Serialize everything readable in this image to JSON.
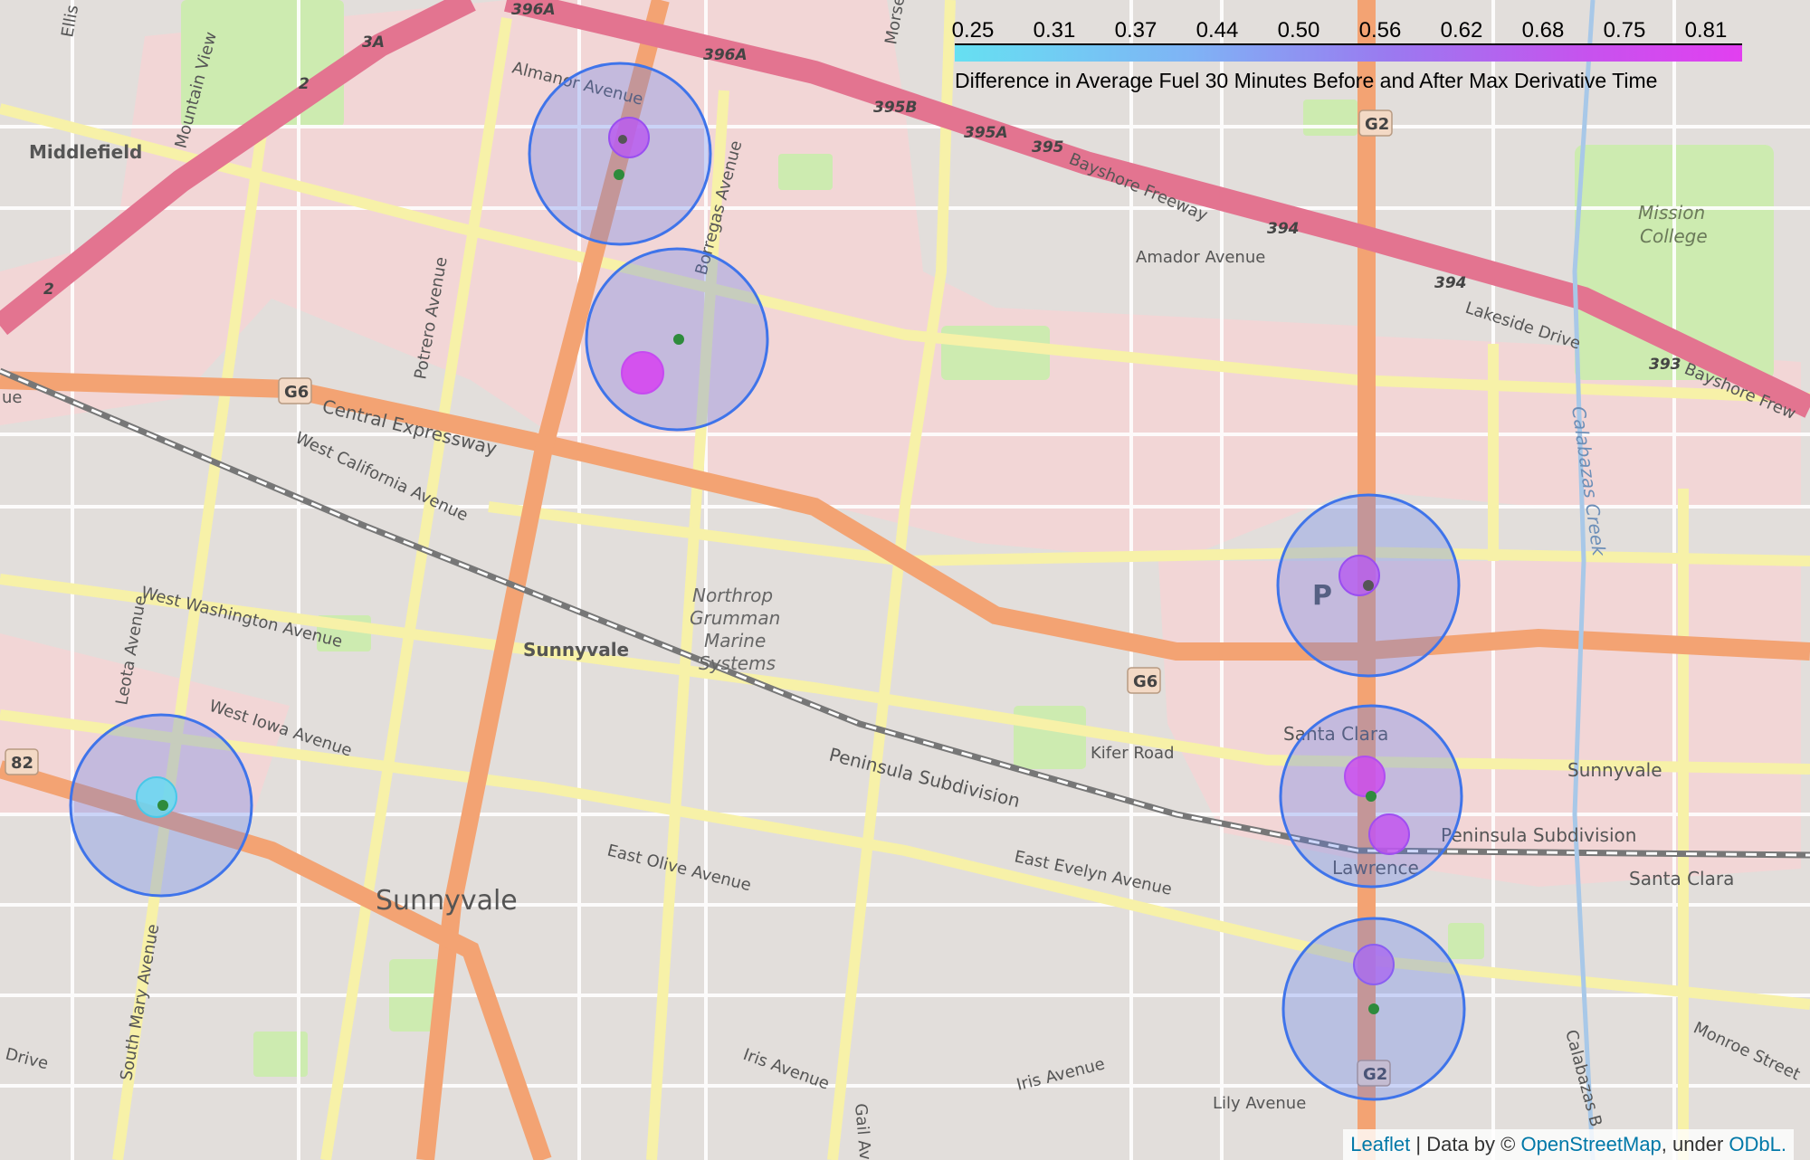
{
  "legend": {
    "ticks": [
      "0.25",
      "0.31",
      "0.37",
      "0.44",
      "0.50",
      "0.56",
      "0.62",
      "0.68",
      "0.75",
      "0.81"
    ],
    "caption": "Difference in Average Fuel 30 Minutes Before and After Max Derivative Time",
    "colors": {
      "low": "#66e0f2",
      "high": "#e23ff0"
    }
  },
  "attribution": {
    "leaflet": "Leaflet",
    "sep": " | Data by © ",
    "osm": "OpenStreetMap",
    "under": ", under ",
    "odbl": "ODbL."
  },
  "places": {
    "sunnyvale_city": "Sunnyvale",
    "sunnyvale_station": "Sunnyvale",
    "middlefield": "Middlefield",
    "lawrence": "Lawrence",
    "santa_clara_1": "Santa Clara",
    "santa_clara_2": "Santa Clara",
    "sunnyvale_east": "Sunnyvale",
    "mission_college_1": "Mission",
    "mission_college_2": "College",
    "northrop_1": "Northrop",
    "northrop_2": "Grumman",
    "northrop_3": "Marine",
    "northrop_4": "Systems",
    "peninsula_1": "Peninsula Subdivision",
    "peninsula_2": "Peninsula Subdivision",
    "parking": "P"
  },
  "streets": {
    "almanor": "Almanor Avenue",
    "borregas": "Borregas Avenue",
    "bayshore_1": "Bayshore Freeway",
    "bayshore_2": "Bayshore Frew",
    "amador": "Amador Avenue",
    "lakeside": "Lakeside Drive",
    "central": "Central Expressway",
    "west_california": "West California Avenue",
    "west_washington": "West Washington Avenue",
    "west_iowa": "West Iowa Avenue",
    "potrero": "Potrero Avenue",
    "leota": "Leota Avenue",
    "kifer": "Kifer Road",
    "east_evelyn": "East Evelyn Avenue",
    "east_olive": "East Olive Avenue",
    "iris_1": "Iris Avenue",
    "iris_2": "Iris Avenue",
    "lily": "Lily Avenue",
    "monroe": "Monroe Street",
    "south_mary": "South Mary Avenue",
    "calabazas": "Calabazas Creek",
    "calabazas_bl": "Calabazas B",
    "mountain_view": "Mountain View",
    "ellis": "Ellis St",
    "morse": "Morse",
    "gail": "Gail Av",
    "drive": "Drive",
    "ue": "ue"
  },
  "shields": {
    "r396a_1": "396A",
    "r396a_2": "396A",
    "r395b": "395B",
    "r395a": "395A",
    "r395": "395",
    "r394_1": "394",
    "r394_2": "394",
    "r393": "393",
    "r3a": "3A",
    "r2_1": "2",
    "r2_2": "2",
    "g2_top": "G2",
    "g2_bottom": "G2",
    "g6_left": "G6",
    "g6_right": "G6",
    "r82": "82"
  },
  "markers": [
    {
      "id": "m1",
      "value": 0.69
    },
    {
      "id": "m2",
      "value": 0.8
    },
    {
      "id": "m3",
      "value": 0.68
    },
    {
      "id": "m4",
      "value": 0.76
    },
    {
      "id": "m5",
      "value": 0.72
    },
    {
      "id": "m6",
      "value": 0.63
    },
    {
      "id": "m7",
      "value": 0.28
    }
  ]
}
